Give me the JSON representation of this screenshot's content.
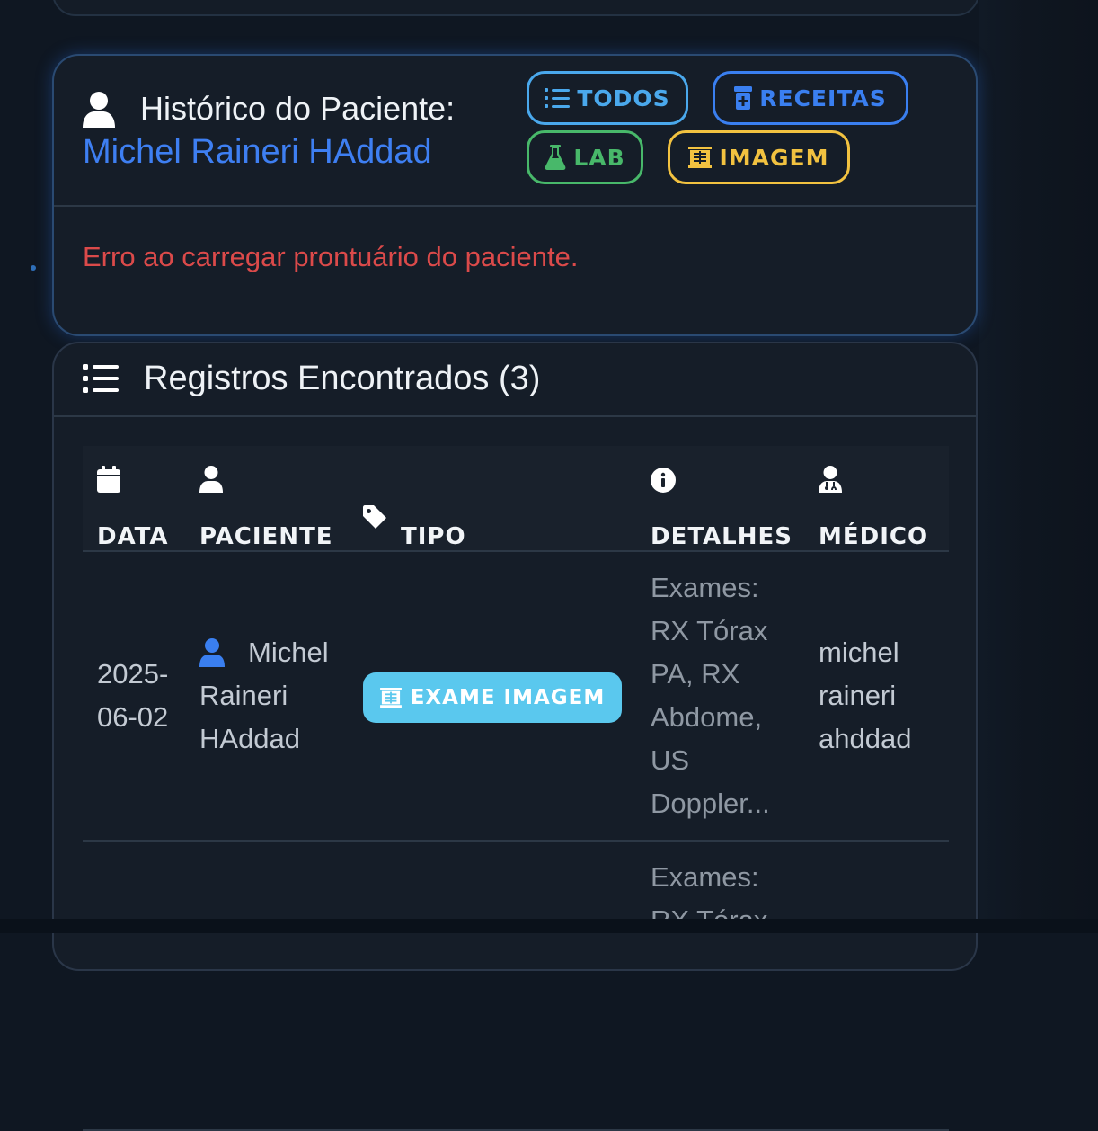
{
  "history": {
    "title": "Histórico do Paciente:",
    "patient_name": "Michel Raineri HAddad",
    "filters": {
      "todos": "TODOS",
      "receitas": "RECEITAS",
      "lab": "LAB",
      "imagem": "IMAGEM"
    },
    "error": "Erro ao carregar prontuário do paciente."
  },
  "records": {
    "title": "Registros Encontrados (3)",
    "columns": {
      "data": "DATA",
      "paciente": "PACIENTE",
      "tipo": "TIPO",
      "detalhes": "DETALHES",
      "medico": "MÉDICO"
    },
    "rows": [
      {
        "date_line1": "2025-",
        "date_line2": "06-02",
        "patient_line1": "Michel",
        "patient_line2": "Raineri",
        "patient_line3": "HAddad",
        "type": "EXAME IMAGEM",
        "details_lines": [
          "Exames:",
          "RX Tórax",
          "PA, RX",
          "Abdome,",
          "US",
          "Doppler..."
        ],
        "doctor_line1": "michel",
        "doctor_line2": "raineri",
        "doctor_line3": "ahddad"
      },
      {
        "details_lines": [
          "Exames:",
          "RX Tórax"
        ]
      }
    ]
  },
  "icons": {
    "user": "user-icon",
    "list": "list-icon",
    "calendar": "calendar-icon",
    "tag": "tag-icon",
    "info": "info-circle-icon",
    "doctor": "user-doctor-icon",
    "prescription": "prescription-bottle-icon",
    "flask": "flask-icon",
    "xray": "x-ray-icon"
  },
  "colors": {
    "background": "#0f1722",
    "card": "#151d28",
    "patient_link": "#3e7ff2",
    "todos": "#4aa8ec",
    "receitas": "#3a7ff0",
    "lab": "#48b86a",
    "imagem": "#f2c240",
    "error": "#db4a4a",
    "badge_imagem": "#5ac8ee"
  }
}
